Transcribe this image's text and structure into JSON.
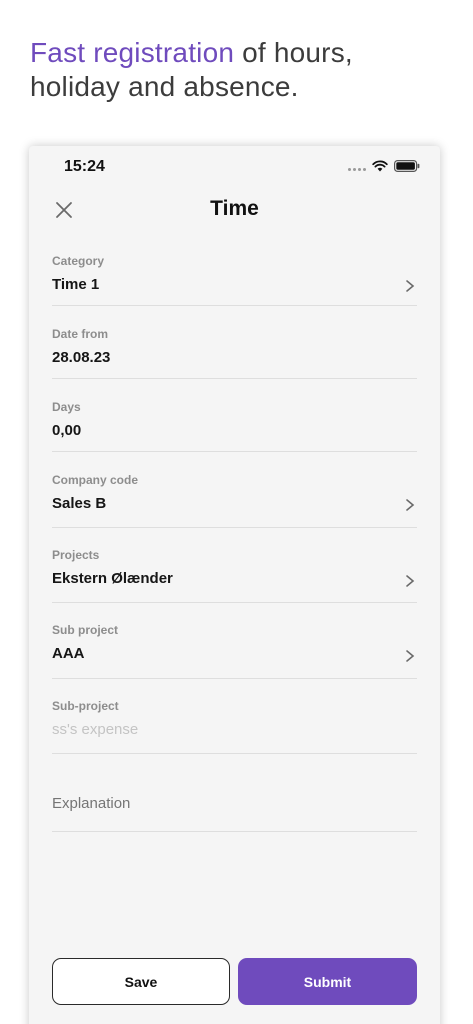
{
  "headline": {
    "accent": "Fast registration",
    "rest": " of hours, holiday and absence."
  },
  "status_bar": {
    "time": "15:24"
  },
  "nav": {
    "title": "Time"
  },
  "fields": [
    {
      "label": "Category",
      "value": "Time 1",
      "chevron": true
    },
    {
      "label": "Date from",
      "value": "28.08.23",
      "chevron": false
    },
    {
      "label": "Days",
      "value": "0,00",
      "chevron": false
    },
    {
      "label": "Company code",
      "value": "Sales B",
      "chevron": true
    },
    {
      "label": "Projects",
      "value": "Ekstern Ølænder",
      "chevron": true
    },
    {
      "label": "Sub project",
      "value": "AAA",
      "chevron": true
    },
    {
      "label": "Sub-project",
      "placeholder": "ss's expense",
      "chevron": false
    }
  ],
  "explanation": {
    "placeholder": "Explanation"
  },
  "buttons": {
    "save": "Save",
    "submit": "Submit"
  },
  "colors": {
    "accent": "#6f4bbd",
    "background": "#f5f5f5"
  }
}
